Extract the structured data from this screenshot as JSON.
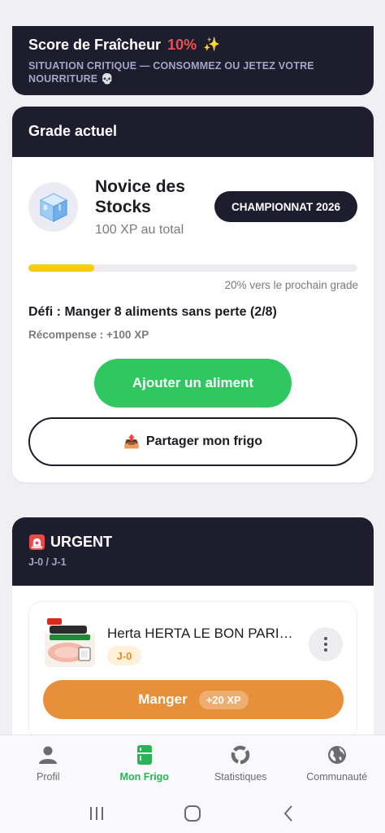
{
  "score": {
    "title": "Score de Fraîcheur",
    "value": "10%",
    "sparkle": "✨",
    "subtitle": "SITUATION CRITIQUE — CONSOMMEZ OU JETEZ VOTRE NOURRITURE 💀"
  },
  "grade": {
    "header": "Grade actuel",
    "rank_name": "Novice des Stocks",
    "xp_total": "100 XP au total",
    "championship_badge": "CHAMPIONNAT 2026",
    "progress_fraction": 0.2,
    "progress_label": "20% vers le prochain grade",
    "challenge": "Défi : Manger 8 aliments sans perte (2/8)",
    "reward": "Récompense : +100 XP",
    "add_button": "Ajouter un aliment",
    "share_button": "Partager mon frigo",
    "share_icon": "📤"
  },
  "urgent": {
    "title": "URGENT",
    "subtitle": "J-0 / J-1",
    "icon": "siren-icon",
    "items": [
      {
        "name": "Herta HERTA LE BON PARIS à l'Étouffée",
        "image": "ham-package-image",
        "day_badge": "J-0",
        "eat_label": "Manger",
        "xp_reward": "+20 XP"
      }
    ]
  },
  "nav": {
    "items": [
      {
        "label": "Profil",
        "icon": "person-icon",
        "active": false
      },
      {
        "label": "Mon Frigo",
        "icon": "fridge-icon",
        "active": true
      },
      {
        "label": "Statistiques",
        "icon": "donut-chart-icon",
        "active": false
      },
      {
        "label": "Communauté",
        "icon": "globe-icon",
        "active": false
      }
    ]
  },
  "colors": {
    "dark": "#1d1d2e",
    "green": "#30c760",
    "orange": "#e88f3a",
    "critical_red": "#f24e4e",
    "progress_yellow": "#f5cd0c",
    "nav_active": "#2bb457"
  }
}
